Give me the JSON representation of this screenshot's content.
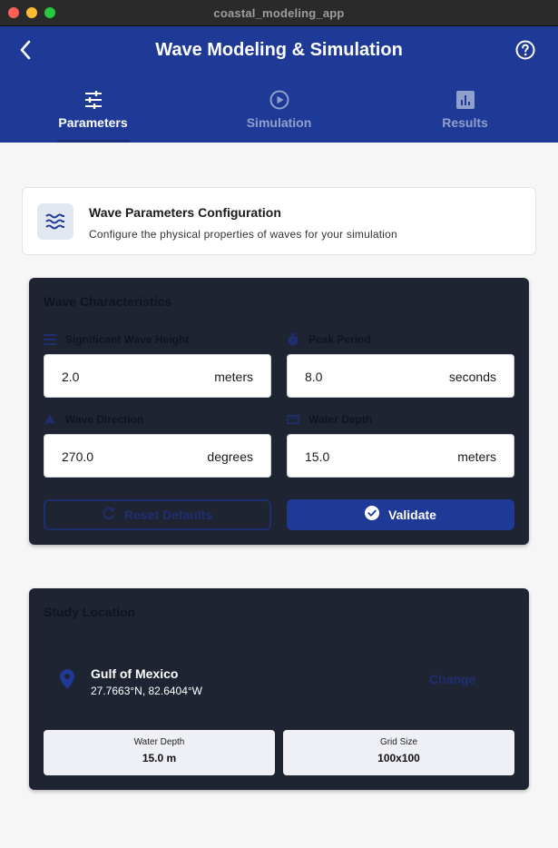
{
  "window": {
    "title": "coastal_modeling_app"
  },
  "appbar": {
    "title": "Wave Modeling & Simulation",
    "back_icon": "arrow-back-icon",
    "help_icon": "help-circle-icon"
  },
  "tabs": [
    {
      "label": "Parameters",
      "icon": "tune-icon",
      "active": true
    },
    {
      "label": "Simulation",
      "icon": "play-circle-icon",
      "active": false
    },
    {
      "label": "Results",
      "icon": "bar-chart-icon",
      "active": false
    }
  ],
  "info_card": {
    "title": "Wave Parameters Configuration",
    "subtitle": "Configure the physical properties of waves for your simulation",
    "icon": "waves-icon"
  },
  "wave_characteristics": {
    "title": "Wave Characteristics",
    "fields": [
      {
        "label": "Significant Wave Height",
        "value": "2.0",
        "unit": "meters",
        "icon": "height-icon"
      },
      {
        "label": "Peak Period",
        "value": "8.0",
        "unit": "seconds",
        "icon": "timer-icon"
      },
      {
        "label": "Wave Direction",
        "value": "270.0",
        "unit": "degrees",
        "icon": "navigation-icon"
      },
      {
        "label": "Water Depth",
        "value": "15.0",
        "unit": "meters",
        "icon": "straighten-icon"
      }
    ],
    "reset_label": "Reset Defaults",
    "validate_label": "Validate"
  },
  "study_location": {
    "title": "Study Location",
    "name": "Gulf of Mexico",
    "coords": "27.7663°N, 82.6404°W",
    "change_label": "Change",
    "stats": [
      {
        "label": "Water Depth",
        "value": "15.0 m"
      },
      {
        "label": "Grid Size",
        "value": "100x100"
      }
    ]
  },
  "colors": {
    "primary": "#1e3a96",
    "panel_bg": "#1f2433",
    "background": "#f6f6f6"
  }
}
